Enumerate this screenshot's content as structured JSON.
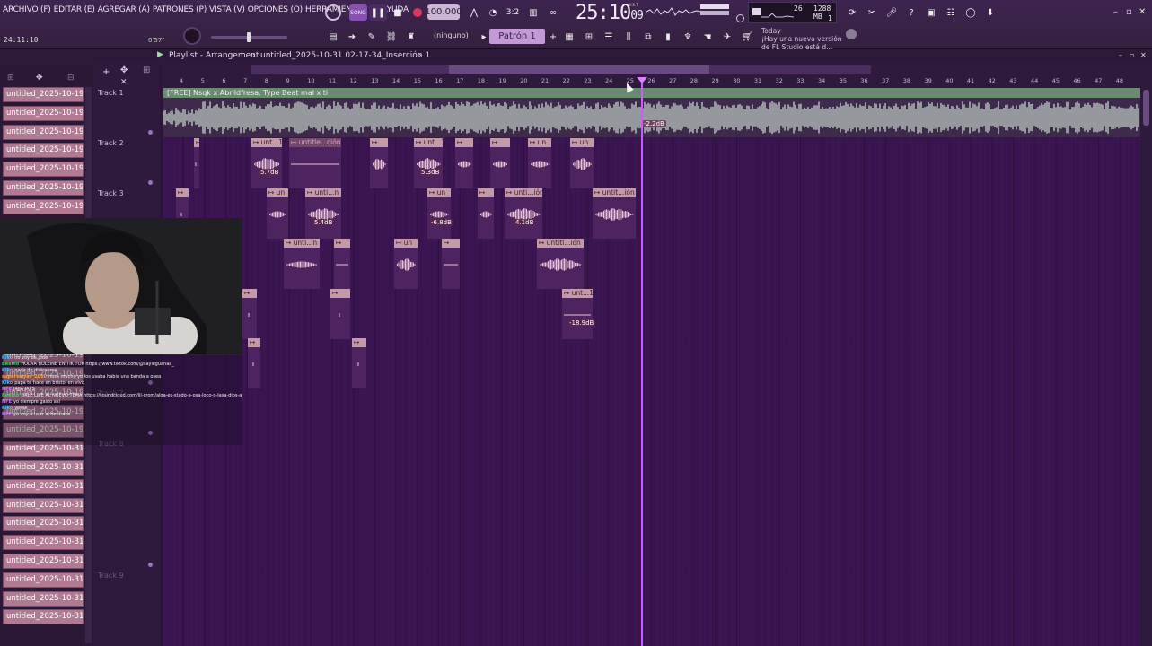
{
  "menu": [
    "ARCHIVO (F)",
    "EDITAR (E)",
    "AGREGAR (A)",
    "PATRONES (P)",
    "VISTA (V)",
    "OPCIONES (O)",
    "HERRAMIENTAS (T)",
    "AYUDA"
  ],
  "system_clock": "24:11:10",
  "small_readout": "0'57\"",
  "transport": {
    "mode_label": "SONG",
    "tempo": "100.000",
    "time_main": "25:10",
    "time_sub": "09",
    "time_mode": "B:S:T"
  },
  "cpu": {
    "voices": "26",
    "memory": "1288 MB",
    "polyphony": "1"
  },
  "pattern": {
    "label": "Patrón 1",
    "snap": "(ninguno)"
  },
  "hint": {
    "label": "Today",
    "text": "¡Hay una nueva versión de FL Studio está d..."
  },
  "playlist": {
    "title": "Playlist - Arrangement",
    "crumb": "untitled_2025-10-31 02-17-34_Inserción 1"
  },
  "browser_items": [
    "untitled_2025-10-19 21-...",
    "untitled_2025-10-19 21-...",
    "untitled_2025-10-19 21-...",
    "untitled_2025-10-19 21-...",
    "untitled_2025-10-19 21-...",
    "untitled_2025-10-19 21-...",
    "untitled_2025-10-19 21-...",
    "untitled_2025-10-19 21-...",
    "untitled_2025-10-19 21-...",
    "untitled_2025-10-19 21-...",
    "untitled_2025-10-19 21-...",
    "untitled_2025-10-19 21-...",
    "untitled_2025-10-19 21-...",
    "untitled_2025-10-19 21-...",
    "untitled_2025-10-19 21-...",
    "untitled_2025-10-19 21-...",
    "untitled_2025-10-19 21-...",
    "untitled_2025-10-19 21-...",
    "untitled_2025-10-19 21-...",
    "untitled_2025-10-31 02-...",
    "untitled_2025-10-31 02-...",
    "untitled_2025-10-31 02-...",
    "untitled_2025-10-31 02-...",
    "untitled_2025-10-31 02-...",
    "untitled_2025-10-31 02-...",
    "untitled_2025-10-31 02-...",
    "untitled_2025-10-31 02-...",
    "untitled_2025-10-31 02-...",
    "untitled_2025-10-31 02-..."
  ],
  "tracks": [
    "Track 1",
    "Track 2",
    "Track 3",
    "Track 7",
    "Track 8",
    "Track 9"
  ],
  "ruler_numbers": [
    "4",
    "5",
    "6",
    "7",
    "8",
    "9",
    "10",
    "11",
    "12",
    "13",
    "14",
    "15",
    "16",
    "17",
    "18",
    "19",
    "20",
    "21",
    "22",
    "23",
    "24",
    "25",
    "26",
    "27",
    "28",
    "29",
    "30",
    "31",
    "32",
    "33",
    "34",
    "35",
    "36",
    "37",
    "38",
    "39",
    "40",
    "41",
    "42",
    "43",
    "44",
    "45",
    "46",
    "47",
    "48"
  ],
  "main_clip": {
    "label": "[FREE] Nsqk x Abrildfresa, Type Beat mal x ti",
    "db": "-2.2dB"
  },
  "clips": [
    {
      "label": "",
      "db": ""
    },
    {
      "label": "unt...1",
      "db": "5.7dB"
    },
    {
      "label": "untitle...ción 1",
      "db": ""
    },
    {
      "label": "",
      "db": ""
    },
    {
      "label": "unt...1",
      "db": "5.3dB"
    },
    {
      "label": "",
      "db": ""
    },
    {
      "label": "",
      "db": ""
    },
    {
      "label": "un",
      "db": ""
    },
    {
      "label": "un",
      "db": ""
    },
    {
      "label": "",
      "db": ""
    },
    {
      "label": "un",
      "db": ""
    },
    {
      "label": "unti...n 1",
      "db": "5.4dB"
    },
    {
      "label": "un",
      "db": "-6.8dB"
    },
    {
      "label": "",
      "db": ""
    },
    {
      "label": "unti...ión 1",
      "db": "4.1dB"
    },
    {
      "label": "untit...ión 1",
      "db": ""
    },
    {
      "label": "unti...n 1",
      "db": ""
    },
    {
      "label": "",
      "db": ""
    },
    {
      "label": "un",
      "db": ""
    },
    {
      "label": "",
      "db": ""
    },
    {
      "label": "untitl...ión 1",
      "db": ""
    },
    {
      "label": "",
      "db": ""
    },
    {
      "label": "",
      "db": ""
    },
    {
      "label": "unt...1",
      "db": "-18.9dB"
    },
    {
      "label": "",
      "db": ""
    },
    {
      "label": "",
      "db": ""
    }
  ],
  "chat": [
    {
      "user": "Kiko",
      "color": "#3fbfff",
      "text": "no voy de jode"
    },
    {
      "user": "Beelho",
      "color": "#3fd06a",
      "text": "HOLAA BOLEINE EN TIK TOK https://www.tiktok.com/@saylilguanaa_"
    },
    {
      "user": "Kiko",
      "color": "#3fbfff",
      "text": "nada de distraerse"
    },
    {
      "user": "supersaiyas_2010",
      "color": "#ff9f3f",
      "text": "nosa mucho yo los usaba habia una banda a osea"
    },
    {
      "user": "Kiko",
      "color": "#3fbfff",
      "text": "papa te hace en bristol en vivo"
    },
    {
      "user": "NFE",
      "color": "#c07cff",
      "text": "JAJJA JAJJS"
    },
    {
      "user": "Beelho",
      "color": "#3fd06a",
      "text": "DALE LIKE AL NUEVO TEMA https://soundcloud.com/lil-crom/alga-es-stado-a-osa-loco-n-lasa-dios-at"
    },
    {
      "user": "NFE",
      "color": "#c07cff",
      "text": "yo siempre gasto asi"
    },
    {
      "user": "Kiko",
      "color": "#3fbfff",
      "text": "yesse"
    },
    {
      "user": "NFE",
      "color": "#c07cff",
      "text": "yo voy a usar al de drake"
    }
  ]
}
